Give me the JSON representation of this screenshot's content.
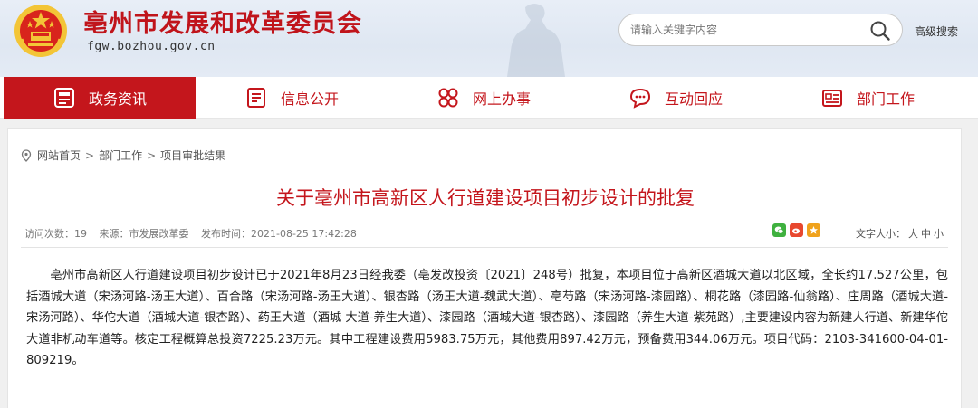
{
  "header": {
    "site_title": "亳州市发展和改革委员会",
    "site_url": "fgw.bozhou.gov.cn",
    "search_placeholder": "请输入关键字内容",
    "advanced_search": "高级搜索"
  },
  "nav": {
    "items": [
      {
        "label": "政务资讯",
        "icon": "news-icon",
        "active": true
      },
      {
        "label": "信息公开",
        "icon": "document-icon",
        "active": false
      },
      {
        "label": "网上办事",
        "icon": "services-icon",
        "active": false
      },
      {
        "label": "互动回应",
        "icon": "chat-icon",
        "active": false
      },
      {
        "label": "部门工作",
        "icon": "department-icon",
        "active": false
      }
    ]
  },
  "breadcrumb": [
    "网站首页",
    "部门工作",
    "项目审批结果"
  ],
  "breadcrumb_sep": ">",
  "article": {
    "title": "关于亳州市高新区人行道建设项目初步设计的批复",
    "visits": "访问次数：19",
    "source": "来源：市发展改革委",
    "published": "发布时间：2021-08-25 17:42:28",
    "font_size_label": "文字大小：",
    "font_sizes": [
      "大",
      "中",
      "小"
    ],
    "share_icons": [
      "wechat-icon",
      "weibo-icon",
      "favorite-icon"
    ],
    "body": "亳州市高新区人行道建设项目初步设计已于2021年8月23日经我委（亳发改投资〔2021〕248号）批复，本项目位于高新区酒城大道以北区域，全长约17.527公里，包括酒城大道（宋汤河路-汤王大道）、百合路（宋汤河路-汤王大道）、银杏路（汤王大道-魏武大道）、亳芍路（宋汤河路-漆园路）、桐花路（漆园路-仙翁路）、庄周路（酒城大道-宋汤河路）、华佗大道（酒城大道-银杏路）、药王大道（酒城 大道-养生大道）、漆园路（酒城大道-银杏路）、漆园路（养生大道-紫苑路）,主要建设内容为新建人行道、新建华佗大道非机动车道等。核定工程概算总投资7225.23万元。其中工程建设费用5983.75万元，其他费用897.42万元，预备费用344.06万元。项目代码：2103-341600-04-01-809219。"
  },
  "colors": {
    "brand_red": "#c4161c",
    "title_red": "#c0141b",
    "emblem_gold": "#f3c537"
  }
}
